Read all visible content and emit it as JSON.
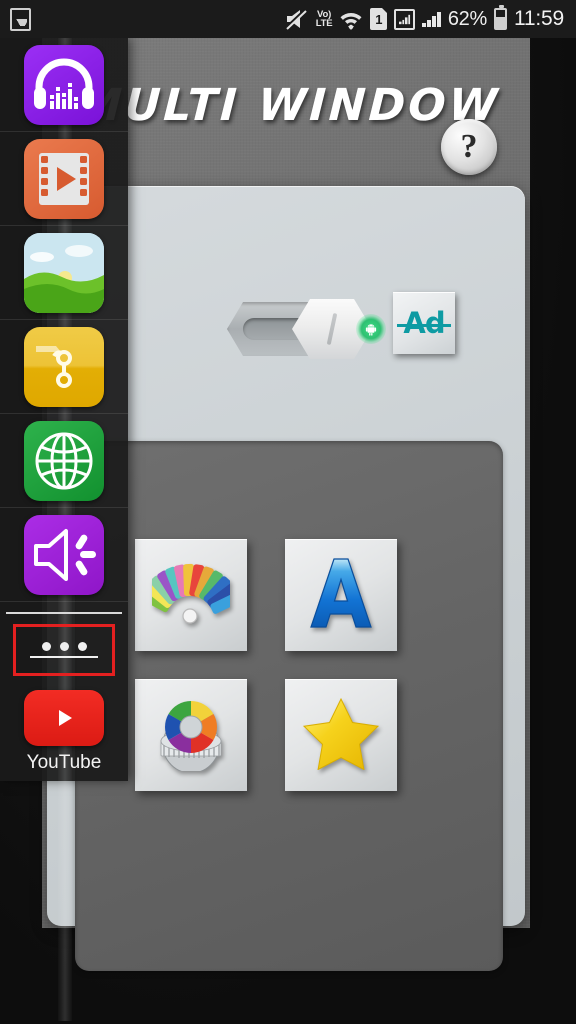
{
  "status_bar": {
    "left_icon": "gallery-icon",
    "icons": [
      "mute-icon",
      "volte-icon",
      "wifi-icon",
      "sim1-icon",
      "signal-boxed-icon",
      "signal-bars-icon"
    ],
    "volte_top": "Vo)",
    "volte_bottom": "LTE",
    "sim_label": "1",
    "battery_percent": "62%",
    "clock": "11:59"
  },
  "app": {
    "title": "MULTI WINDOW",
    "help_label": "?",
    "toggle": {
      "name": "enable-toggle",
      "state": "on",
      "led_color": "#3ddc84"
    },
    "ad_button": {
      "label": "Ad",
      "color": "#0e9ba3",
      "meaning": "remove-ads"
    },
    "grid_buttons": [
      {
        "name": "color-swatch-button",
        "icon": "color-swatch-fan-icon",
        "label": ""
      },
      {
        "name": "font-button",
        "icon": "letter-a-icon",
        "label": ""
      },
      {
        "name": "color-wheel-settings-button",
        "icon": "color-wheel-gear-icon",
        "label": ""
      },
      {
        "name": "rate-button",
        "icon": "star-icon",
        "label": ""
      }
    ]
  },
  "sidebar": {
    "items": [
      {
        "name": "sidebar-item-music",
        "icon": "headphones-equalizer-icon",
        "color": "#8b1ce8"
      },
      {
        "name": "sidebar-item-video",
        "icon": "film-play-icon",
        "color": "#e2673c"
      },
      {
        "name": "sidebar-item-gallery",
        "icon": "landscape-photo-icon",
        "color": "#8fcf3f"
      },
      {
        "name": "sidebar-item-files",
        "icon": "folder-pin-icon",
        "color": "#e8b70d"
      },
      {
        "name": "sidebar-item-browser",
        "icon": "globe-icon",
        "color": "#1ba03c"
      },
      {
        "name": "sidebar-item-sound",
        "icon": "speaker-volume-icon",
        "color": "#9b1fd6"
      }
    ],
    "more_button": {
      "name": "more-options-button",
      "dots": "•••",
      "highlight_color": "#e42020"
    },
    "youtube": {
      "name": "sidebar-item-youtube",
      "label": "YouTube",
      "color": "#dc1b14"
    }
  }
}
